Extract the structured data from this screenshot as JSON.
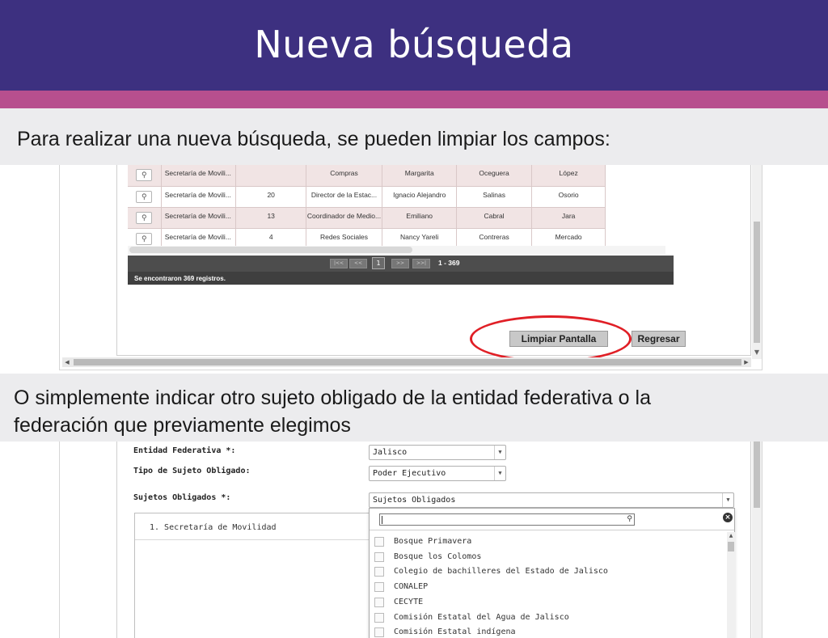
{
  "slide": {
    "title": "Nueva búsqueda",
    "caption_top": "Para realizar una nueva búsqueda, se pueden limpiar los campos:",
    "caption_middle_line1": "O simplemente indicar otro sujeto obligado de la entidad federativa o la",
    "caption_middle_line2": "federación que previamente elegimos",
    "colors": {
      "header": "#3d3080",
      "stripe": "#b74f8e",
      "caption_bg": "#ececee",
      "highlight": "#e01f26"
    }
  },
  "results": {
    "rows": [
      {
        "dependencia": "Secretaría de Movili...",
        "numero": "",
        "puesto": "Compras",
        "nombre": "Margarita",
        "apellido1": "Oceguera",
        "apellido2": "López"
      },
      {
        "dependencia": "Secretaría de Movili...",
        "numero": "20",
        "puesto": "Director de la Estac...",
        "nombre": "Ignacio Alejandro",
        "apellido1": "Salinas",
        "apellido2": "Osorio"
      },
      {
        "dependencia": "Secretaría de Movili...",
        "numero": "13",
        "puesto": "Coordinador de Medio...",
        "nombre": "Emiliano",
        "apellido1": "Cabral",
        "apellido2": "Jara"
      },
      {
        "dependencia": "Secretaría de Movili...",
        "numero": "4",
        "puesto": "Redes Sociales",
        "nombre": "Nancy Yareli",
        "apellido1": "Contreras",
        "apellido2": "Mercado"
      }
    ],
    "pager": {
      "first": "|<<",
      "prev": "<<",
      "page": "1",
      "next": ">>",
      "last": ">>|",
      "range": "1 - 369"
    },
    "records_text": "Se encontraron 369 registros.",
    "clear_button": "Limpiar Pantalla",
    "back_button": "Regresar",
    "icons": {
      "view": "magnifier-icon"
    }
  },
  "form": {
    "entidad_label": "Entidad Federativa *:",
    "entidad_value": "Jalisco",
    "tipo_label": "Tipo de Sujeto Obligado:",
    "tipo_value": "Poder Ejecutivo",
    "sujetos_label": "Sujetos Obligados *:",
    "sujetos_value": "Sujetos Obligados",
    "selected_item": "1. Secretaría de Movilidad",
    "dropdown_options": [
      "Bosque Primavera",
      "Bosque los Colomos",
      "Colegio de bachilleres del Estado de Jalisco",
      "CONALEP",
      "CECYTE",
      "Comisión Estatal del Agua de Jalisco",
      "Comisión Estatal indígena"
    ]
  }
}
